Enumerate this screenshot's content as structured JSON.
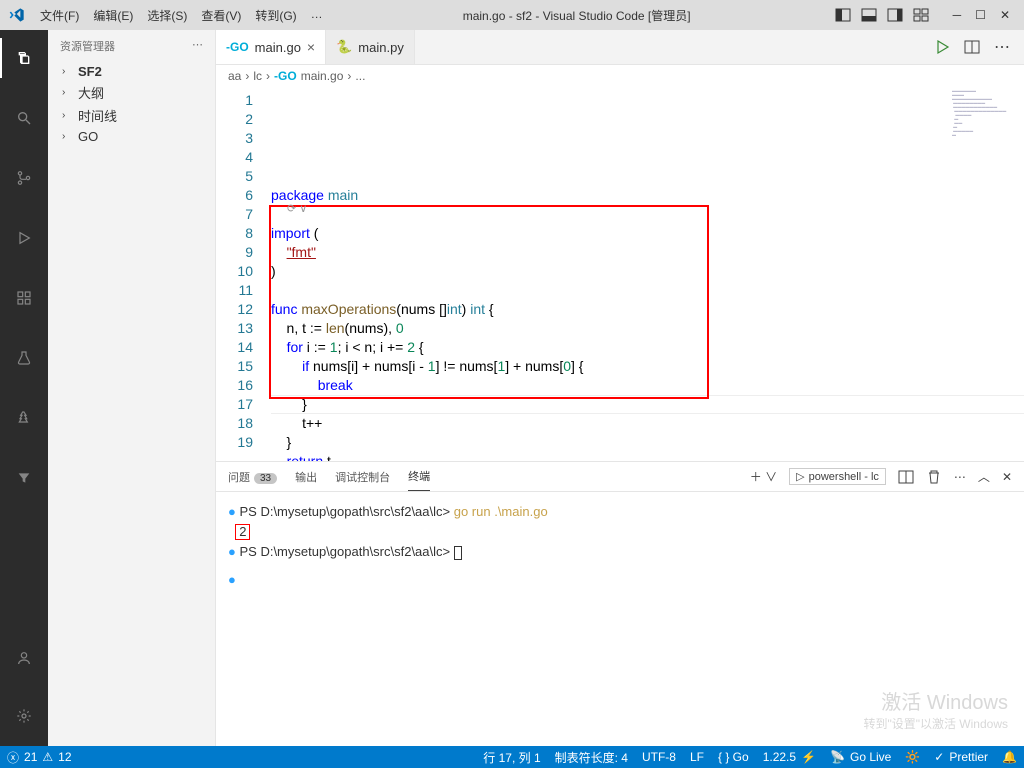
{
  "window": {
    "title": "main.go - sf2 - Visual Studio Code [管理员]"
  },
  "menu": {
    "file": "文件(F)",
    "edit": "编辑(E)",
    "select": "选择(S)",
    "view": "查看(V)",
    "go": "转到(G)",
    "more": "…"
  },
  "sidebar": {
    "title": "资源管理器",
    "items": [
      {
        "label": "SF2",
        "bold": true
      },
      {
        "label": "大纲"
      },
      {
        "label": "时间线"
      },
      {
        "label": "GO"
      }
    ]
  },
  "tabs": {
    "active": "main.go",
    "other": "main.py"
  },
  "breadcrumb": {
    "a": "aa",
    "b": "lc",
    "c": "main.go",
    "d": "..."
  },
  "code": {
    "lines": [
      {
        "n": 1,
        "html": "<span class='kw'>package</span> <span class='pkg'>main</span>"
      },
      {
        "n": 2,
        "html": ""
      },
      {
        "n": 3,
        "html": "<span class='kw'>import</span> ("
      },
      {
        "n": 4,
        "html": "    <span class='strU'>\"fmt\"</span>"
      },
      {
        "n": 5,
        "html": ")"
      },
      {
        "n": 6,
        "html": ""
      },
      {
        "n": 7,
        "html": "<span class='kw'>func</span> <span class='fn'>maxOperations</span>(nums []<span class='ty'>int</span>) <span class='ty'>int</span> {"
      },
      {
        "n": 8,
        "html": "    n, t := <span class='fn'>len</span>(nums), <span class='num'>0</span>"
      },
      {
        "n": 9,
        "html": "    <span class='kw'>for</span> i := <span class='num'>1</span>; i &lt; n; i += <span class='num'>2</span> {"
      },
      {
        "n": 10,
        "html": "        <span class='kw'>if</span> nums[i] + nums[i - <span class='num'>1</span>] != nums[<span class='num'>1</span>] + nums[<span class='num'>0</span>] {"
      },
      {
        "n": 11,
        "html": "            <span class='kw'>break</span>"
      },
      {
        "n": 12,
        "html": "        }"
      },
      {
        "n": 13,
        "html": "        t++"
      },
      {
        "n": 14,
        "html": "    }"
      },
      {
        "n": 15,
        "html": "    <span class='kw'>return</span> t"
      },
      {
        "n": 16,
        "html": "}"
      },
      {
        "n": 17,
        "html": ""
      },
      {
        "n": 18,
        "html": ""
      },
      {
        "n": 19,
        "html": ""
      }
    ]
  },
  "panel": {
    "tabs": {
      "problems": "问题",
      "count": "33",
      "output": "输出",
      "debug": "调试控制台",
      "terminal": "终端"
    },
    "termsel": "powershell - lc",
    "lines": [
      "PS D:\\mysetup\\gopath\\src\\sf2\\aa\\lc> ",
      "go run .\\main.go",
      "2",
      "PS D:\\mysetup\\gopath\\src\\sf2\\aa\\lc> "
    ]
  },
  "status": {
    "errors": "21",
    "warnings": "12",
    "lncol": "行 17, 列 1",
    "tab": "制表符长度: 4",
    "enc": "UTF-8",
    "eol": "LF",
    "lang": "{ } Go",
    "ver": "1.22.5",
    "golive": "Go Live",
    "prettier": "Prettier"
  },
  "watermark": {
    "t": "激活 Windows",
    "s": "转到\"设置\"以激活 Windows"
  }
}
